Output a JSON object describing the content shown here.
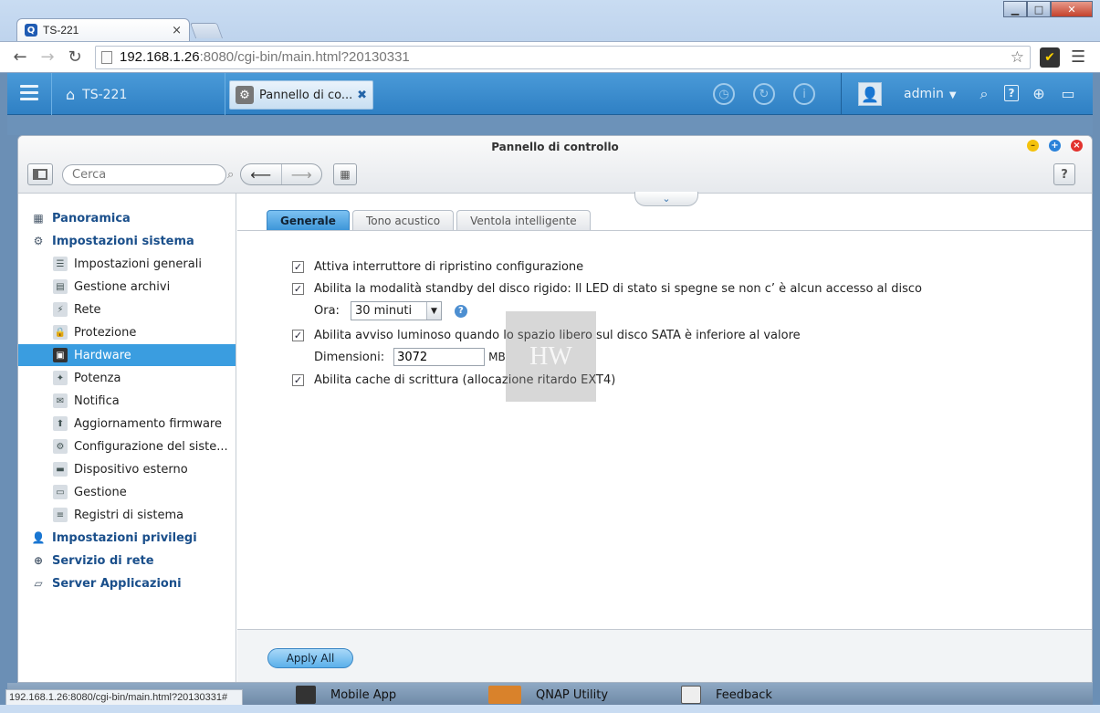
{
  "browser": {
    "tab_title": "TS-221",
    "tab_favicon": "Q",
    "url_host": "192.168.1.26",
    "url_rest": ":8080/cgi-bin/main.html?20130331",
    "status_url": "192.168.1.26:8080/cgi-bin/main.html?20130331#"
  },
  "topbar": {
    "home_label": "TS-221",
    "app_title": "Pannello di co...",
    "user": "admin"
  },
  "window": {
    "title": "Pannello di controllo",
    "search_placeholder": "Cerca"
  },
  "sidebar": {
    "items": [
      {
        "label": "Panoramica",
        "icon": "grid-icon"
      },
      {
        "label": "Impostazioni sistema",
        "icon": "gear-icon"
      },
      {
        "label": "Impostazioni generali",
        "icon": "settings-icon"
      },
      {
        "label": "Gestione archivi",
        "icon": "storage-icon"
      },
      {
        "label": "Rete",
        "icon": "network-icon"
      },
      {
        "label": "Protezione",
        "icon": "lock-icon"
      },
      {
        "label": "Hardware",
        "icon": "hardware-icon"
      },
      {
        "label": "Potenza",
        "icon": "bulb-icon"
      },
      {
        "label": "Notifica",
        "icon": "notification-icon"
      },
      {
        "label": "Aggiornamento firmware",
        "icon": "firmware-icon"
      },
      {
        "label": "Configurazione del siste...",
        "icon": "config-icon"
      },
      {
        "label": "Dispositivo esterno",
        "icon": "external-device-icon"
      },
      {
        "label": "Gestione",
        "icon": "monitor-icon"
      },
      {
        "label": "Registri di sistema",
        "icon": "log-icon"
      },
      {
        "label": "Impostazioni privilegi",
        "icon": "user-icon"
      },
      {
        "label": "Servizio di rete",
        "icon": "globe-icon"
      },
      {
        "label": "Server Applicazioni",
        "icon": "app-server-icon"
      }
    ]
  },
  "tabs": [
    "Generale",
    "Tono acustico",
    "Ventola intelligente"
  ],
  "settings": {
    "opt1": "Attiva interruttore di ripristino configurazione",
    "opt2": "Abilita la modalità standby del disco rigido: Il LED di stato si spegne se non c’ è alcun accesso al disco",
    "ora_label": "Ora:",
    "ora_value": "30 minuti",
    "opt3": "Abilita avviso luminoso quando lo spazio libero sul disco SATA è inferiore al valore",
    "dim_label": "Dimensioni:",
    "dim_value": "3072",
    "dim_unit": "MB",
    "opt4": "Abilita cache di scrittura (allocazione ritardo EXT4)"
  },
  "footer": {
    "apply_label": "Apply All"
  },
  "dock": {
    "item1": "Mobile App",
    "item2": "QNAP Utility",
    "item3": "Feedback"
  },
  "colors": {
    "accent": "#3a9de0",
    "topbar": "#2f80c4"
  }
}
